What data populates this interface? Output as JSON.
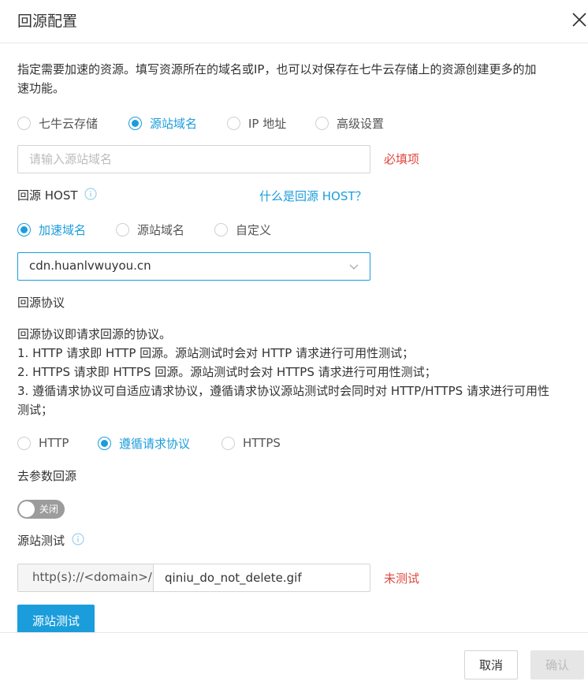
{
  "dialog": {
    "title": "回源配置",
    "close_icon": "close-icon"
  },
  "intro": {
    "line1": "指定需要加速的资源。填写资源所在的域名或IP，也可以对保存在七牛云存储上的资源创建更多的加",
    "line2": "速功能。"
  },
  "source_type": {
    "options": [
      "七牛云存储",
      "源站域名",
      "IP 地址",
      "高级设置"
    ],
    "selected": "源站域名"
  },
  "source_domain": {
    "placeholder": "请输入源站域名",
    "value": "",
    "required_hint": "必填项"
  },
  "host": {
    "label": "回源 HOST",
    "info_icon": "info-icon",
    "help_link": "什么是回源 HOST？",
    "options": [
      "加速域名",
      "源站域名",
      "自定义"
    ],
    "selected": "加速域名",
    "select_value": "cdn.huanlvwuyou.cn",
    "chevron_icon": "chevron-down-icon"
  },
  "protocol": {
    "label": "回源协议",
    "desc": [
      "回源协议即请求回源的协议。",
      "1. HTTP 请求即 HTTP 回源。源站测试时会对 HTTP 请求进行可用性测试；",
      "2. HTTPS 请求即 HTTPS 回源。源站测试时会对 HTTPS 请求进行可用性测试；",
      "3. 遵循请求协议可自适应请求协议，遵循请求协议源站测试时会同时对 HTTP/HTTPS 请求进行可用性",
      "测试；"
    ],
    "options": [
      "HTTP",
      "遵循请求协议",
      "HTTPS"
    ],
    "selected": "遵循请求协议"
  },
  "strip_params": {
    "label": "去参数回源",
    "toggle_label": "关闭",
    "enabled": false
  },
  "source_test": {
    "label": "源站测试",
    "info_icon": "info-icon",
    "prefix": "http(s)://<domain>/",
    "path_value": "qiniu_do_not_delete.gif",
    "status": "未测试",
    "button": "源站测试"
  },
  "footer": {
    "cancel": "取消",
    "confirm": "确认"
  },
  "colors": {
    "accent": "#1b9ddb",
    "error": "#e0473e",
    "toggle_off": "#9c9c9c"
  }
}
